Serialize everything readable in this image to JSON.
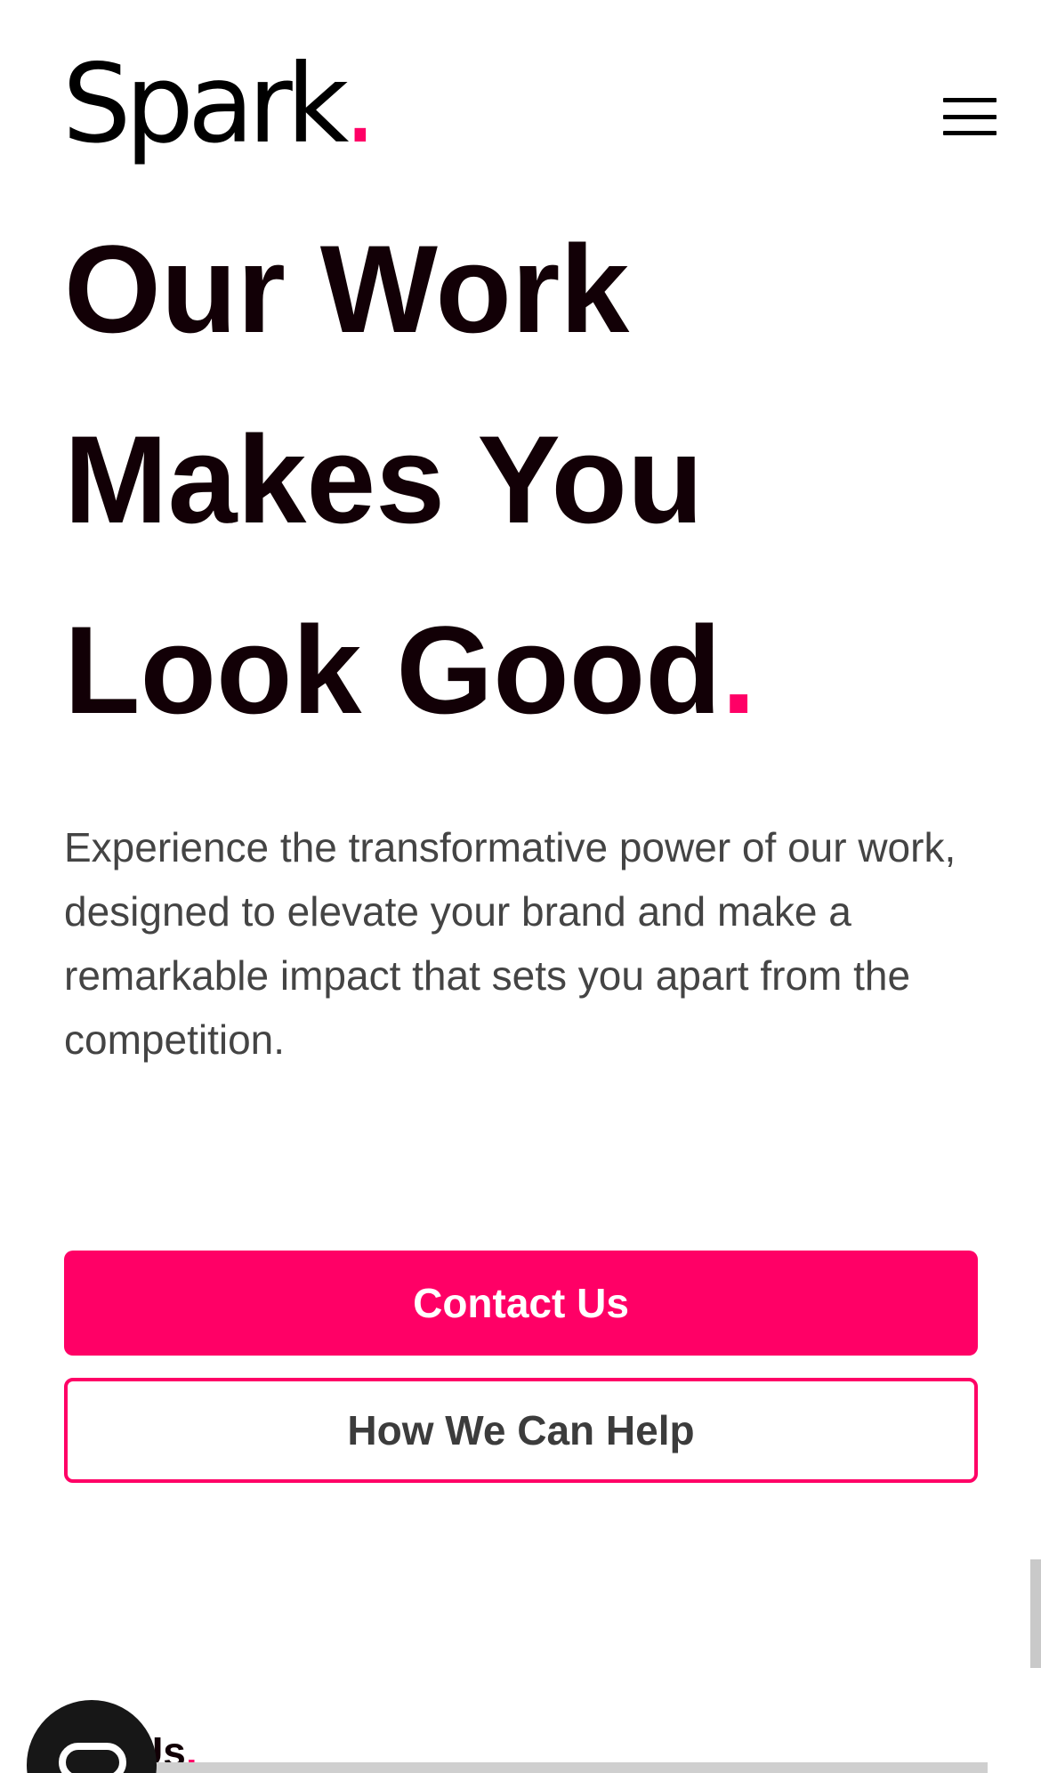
{
  "header": {
    "logo_text": "Spark",
    "logo_dot": ".",
    "menu_icon": "hamburger-menu-icon"
  },
  "hero": {
    "title_lines": [
      "Our Work",
      "Makes You",
      "Look Good"
    ],
    "title_dot": ".",
    "intro": "Experience the transformative power of our work, designed to elevate your brand and make a remarkable impact that sets you apart from the competition."
  },
  "buttons": {
    "contact_label": "Contact Us",
    "help_label": "How We Can Help"
  },
  "next_section": {
    "heading_visible": "Us",
    "heading_dot": "."
  },
  "chat": {
    "icon": "chat-bubble-icon"
  },
  "colors": {
    "accent": "#ff0066",
    "text_dark": "#120006",
    "text_body": "#444444",
    "button_text_secondary": "#3c3c3c"
  }
}
